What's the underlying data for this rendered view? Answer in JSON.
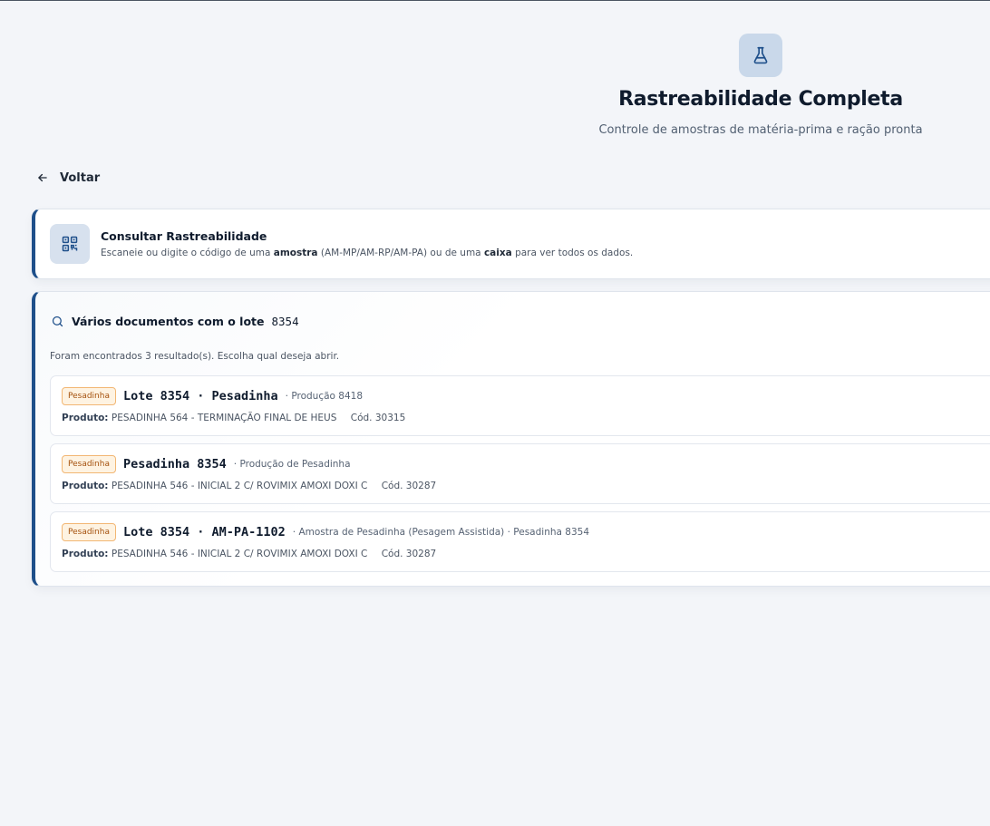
{
  "header": {
    "icon": "flask-icon",
    "title": "Rastreabilidade Completa",
    "subtitle": "Controle de amostras de matéria-prima e ração pronta"
  },
  "back": {
    "label": "Voltar",
    "icon": "arrow-left-icon"
  },
  "consult": {
    "icon": "qr-code-icon",
    "title": "Consultar Rastreabilidade",
    "desc_prefix": "Escaneie ou digite o código de uma ",
    "desc_bold1": "amostra",
    "desc_mid": " (AM-MP/AM-RP/AM-PA) ou de uma ",
    "desc_bold2": "caixa",
    "desc_suffix": " para ver todos os dados."
  },
  "results": {
    "icon": "search-icon",
    "title": "Vários documentos com o lote",
    "lote": "8354",
    "count_text": "Foram encontrados 3 resultado(s). Escolha qual deseja abrir.",
    "product_label": "Produto:",
    "items": [
      {
        "badge": "Pesadinha",
        "title": "Lote 8354 · Pesadinha",
        "subtitle": "· Produção 8418",
        "product": "PESADINHA 564 - TERMINAÇÃO FINAL DE HEUS",
        "code": "Cód. 30315"
      },
      {
        "badge": "Pesadinha",
        "title": "Pesadinha 8354",
        "subtitle": "· Produção de Pesadinha",
        "product": "PESADINHA 546 - INICIAL 2 C/ ROVIMIX AMOXI DOXI C",
        "code": "Cód. 30287"
      },
      {
        "badge": "Pesadinha",
        "title": "Lote 8354 · AM-PA-1102",
        "subtitle": "· Amostra de Pesadinha (Pesagem Assistida) · Pesadinha 8354",
        "product": "PESADINHA 546 - INICIAL 2 C/ ROVIMIX AMOXI DOXI C",
        "code": "Cód. 30287"
      }
    ]
  },
  "colors": {
    "accent": "#1e4f8a",
    "background": "#f3f5f9",
    "badge_bg": "#fef3e2",
    "badge_border": "#f2b774",
    "badge_text": "#a5520f"
  }
}
